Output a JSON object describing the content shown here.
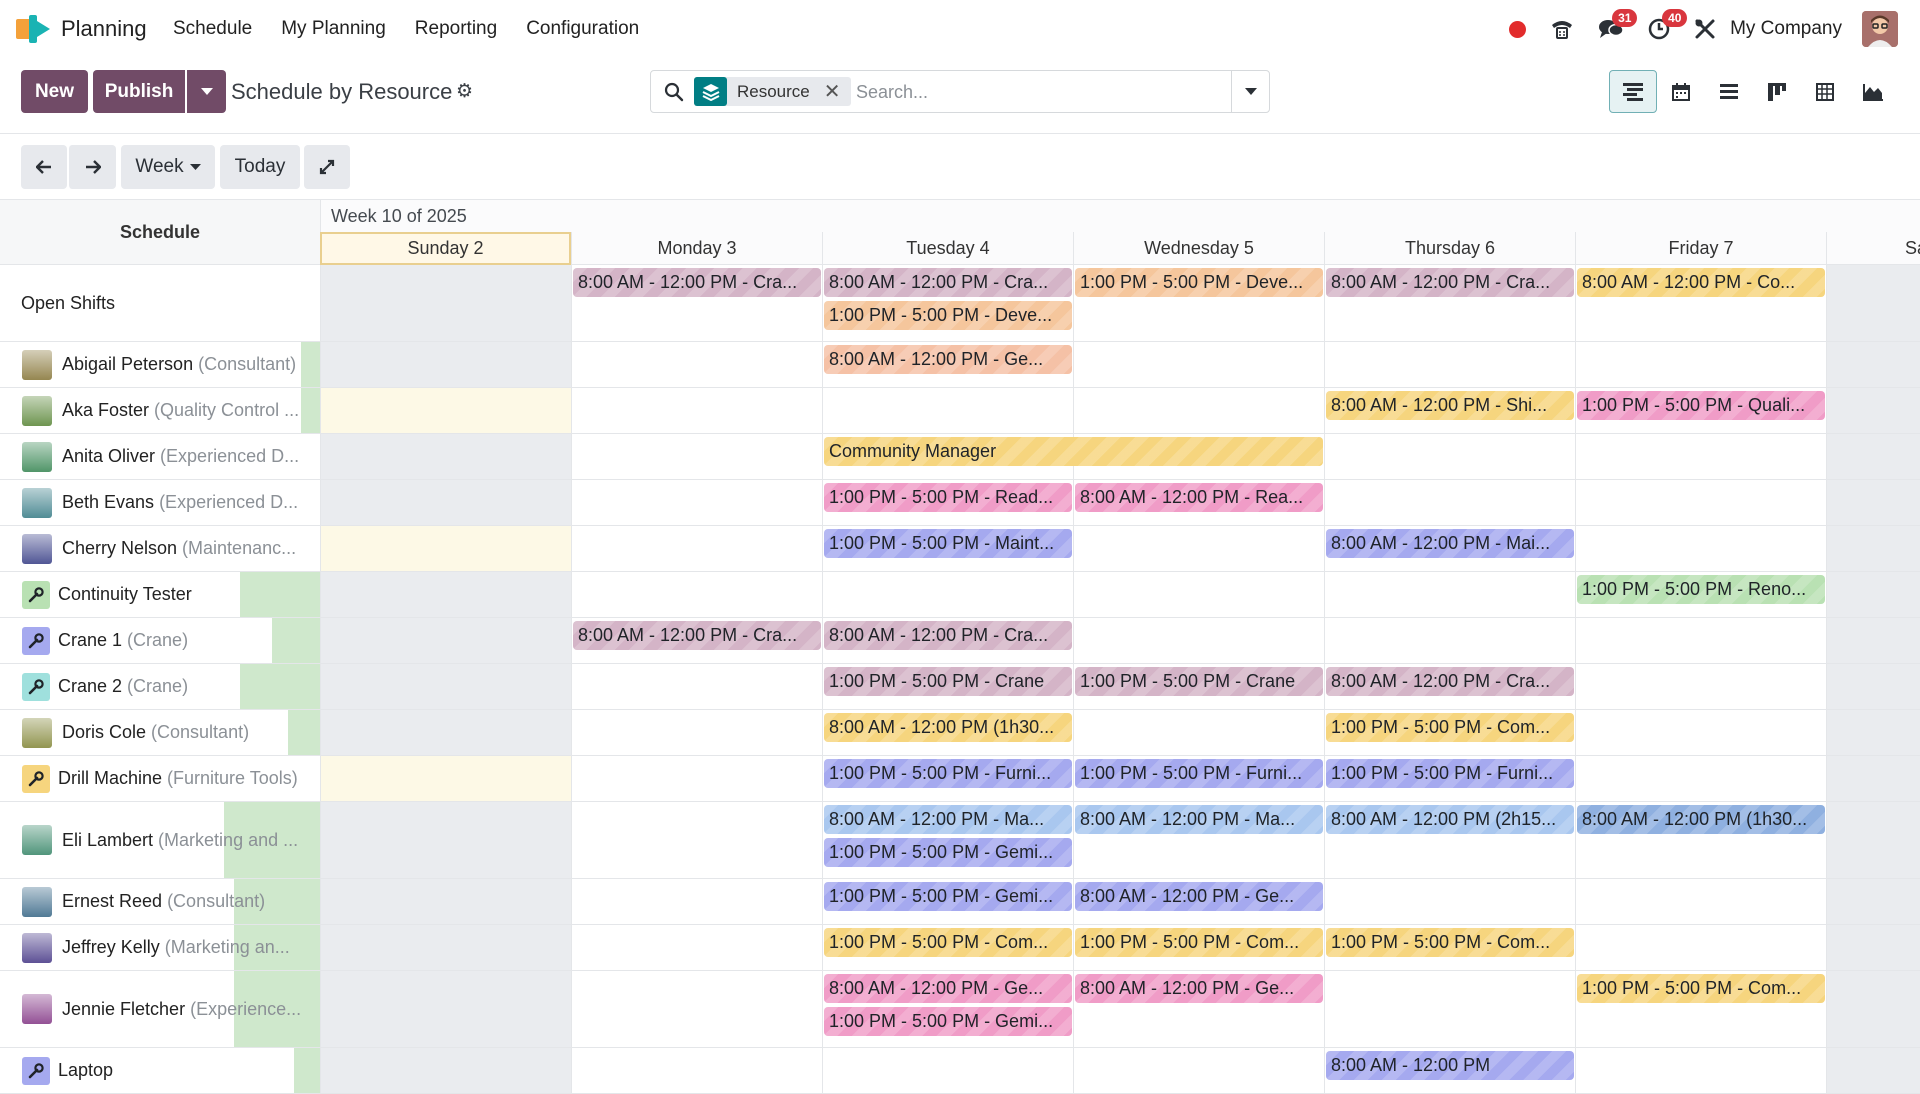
{
  "app": {
    "name": "Planning"
  },
  "nav": {
    "items": [
      "Schedule",
      "My Planning",
      "Reporting",
      "Configuration"
    ]
  },
  "systray": {
    "chat_count": "31",
    "activity_count": "40",
    "company": "My Company"
  },
  "toolbar": {
    "new_label": "New",
    "publish_label": "Publish",
    "title": "Schedule by Resource"
  },
  "search": {
    "facet": "Resource",
    "placeholder": "Search..."
  },
  "subbar": {
    "scale": "Week",
    "today": "Today"
  },
  "gantt": {
    "week_title": "Week 10 of 2025",
    "row_header": "Schedule",
    "days": [
      "Sunday 2",
      "Monday 3",
      "Tuesday 4",
      "Wednesday 5",
      "Thursday 6",
      "Friday 7",
      "Sa"
    ]
  },
  "colors": {
    "brand": "#714b67",
    "today": "#fff8e7",
    "weekend": "#eaecef",
    "availability": "#cfe8cc"
  },
  "rows": [
    {
      "name": "Open Shifts",
      "sub": "",
      "avatar": "none",
      "availability": 0
    },
    {
      "name": "Abigail Peterson",
      "sub": " (Consultant)",
      "avatar": "person",
      "availability": 0.06
    },
    {
      "name": "Aka Foster",
      "sub": " (Quality Control ...",
      "avatar": "person",
      "availability": 0.06
    },
    {
      "name": "Anita Oliver",
      "sub": " (Experienced D...",
      "avatar": "person",
      "availability": 0
    },
    {
      "name": "Beth Evans",
      "sub": " (Experienced D...",
      "avatar": "person",
      "availability": 0
    },
    {
      "name": "Cherry Nelson",
      "sub": " (Maintenanc...",
      "avatar": "person",
      "availability": 0
    },
    {
      "name": "Continuity Tester",
      "sub": "",
      "avatar": "tool",
      "availability": 0.25
    },
    {
      "name": "Crane 1",
      "sub": " (Crane)",
      "avatar": "tool",
      "availability": 0.15
    },
    {
      "name": "Crane 2",
      "sub": " (Crane)",
      "avatar": "tool",
      "availability": 0.25
    },
    {
      "name": "Doris Cole",
      "sub": " (Consultant)",
      "avatar": "person",
      "availability": 0.1
    },
    {
      "name": "Drill Machine",
      "sub": " (Furniture Tools)",
      "avatar": "tool",
      "availability": 0
    },
    {
      "name": "Eli Lambert",
      "sub": " (Marketing and ...",
      "avatar": "person",
      "availability": 0.3
    },
    {
      "name": "Ernest Reed",
      "sub": " (Consultant)",
      "avatar": "person",
      "availability": 0.27
    },
    {
      "name": "Jeffrey Kelly",
      "sub": " (Marketing an...",
      "avatar": "person",
      "availability": 0.27
    },
    {
      "name": "Jennie Fletcher",
      "sub": " (Experience...",
      "avatar": "person",
      "availability": 0.27
    },
    {
      "name": "Laptop",
      "sub": "",
      "avatar": "tool",
      "availability": 0.08
    }
  ],
  "shifts": [
    {
      "row": 0,
      "day": 1,
      "lane": 0,
      "span": 1,
      "text": "8:00 AM - 12:00 PM - Cra...",
      "color": "#d4b4c7"
    },
    {
      "row": 0,
      "day": 2,
      "lane": 0,
      "span": 1,
      "text": "8:00 AM - 12:00 PM - Cra...",
      "color": "#d4b4c7"
    },
    {
      "row": 0,
      "day": 2,
      "lane": 1,
      "span": 1,
      "text": "1:00 PM - 5:00 PM - Deve...",
      "color": "#f5c69c"
    },
    {
      "row": 0,
      "day": 3,
      "lane": 0,
      "span": 1,
      "text": "1:00 PM - 5:00 PM - Deve...",
      "color": "#f5c69c"
    },
    {
      "row": 0,
      "day": 4,
      "lane": 0,
      "span": 1,
      "text": "8:00 AM - 12:00 PM - Cra...",
      "color": "#d4b4c7"
    },
    {
      "row": 0,
      "day": 5,
      "lane": 0,
      "span": 1,
      "text": "8:00 AM - 12:00 PM - Co...",
      "color": "#f6d57e"
    },
    {
      "row": 1,
      "day": 2,
      "lane": 0,
      "span": 1,
      "text": "8:00 AM - 12:00 PM - Ge...",
      "color": "#f5c1a6"
    },
    {
      "row": 2,
      "day": 4,
      "lane": 0,
      "span": 1,
      "text": "8:00 AM - 12:00 PM - Shi...",
      "color": "#f6d57e"
    },
    {
      "row": 2,
      "day": 5,
      "lane": 0,
      "span": 1,
      "text": "1:00 PM - 5:00 PM - Quali...",
      "color": "#f09cc7"
    },
    {
      "row": 3,
      "day": 2,
      "lane": 0,
      "span": 2,
      "text": "Community Manager",
      "color": "#f6d57e"
    },
    {
      "row": 4,
      "day": 2,
      "lane": 0,
      "span": 1,
      "text": "1:00 PM - 5:00 PM - Read...",
      "color": "#f09cc7"
    },
    {
      "row": 4,
      "day": 3,
      "lane": 0,
      "span": 1,
      "text": "8:00 AM - 12:00 PM - Rea...",
      "color": "#f09cc7"
    },
    {
      "row": 5,
      "day": 2,
      "lane": 0,
      "span": 1,
      "text": "1:00 PM - 5:00 PM - Maint...",
      "color": "#a5a9ef"
    },
    {
      "row": 5,
      "day": 4,
      "lane": 0,
      "span": 1,
      "text": "8:00 AM - 12:00 PM - Mai...",
      "color": "#a5a9ef"
    },
    {
      "row": 6,
      "day": 5,
      "lane": 0,
      "span": 1,
      "text": "1:00 PM - 5:00 PM - Reno...",
      "color": "#b9e1b3"
    },
    {
      "row": 7,
      "day": 1,
      "lane": 0,
      "span": 1,
      "text": "8:00 AM - 12:00 PM - Cra...",
      "color": "#d4b4c7"
    },
    {
      "row": 7,
      "day": 2,
      "lane": 0,
      "span": 1,
      "text": "8:00 AM - 12:00 PM - Cra...",
      "color": "#d4b4c7"
    },
    {
      "row": 8,
      "day": 2,
      "lane": 0,
      "span": 1,
      "text": "1:00 PM - 5:00 PM - Crane",
      "color": "#d4b4c7"
    },
    {
      "row": 8,
      "day": 3,
      "lane": 0,
      "span": 1,
      "text": "1:00 PM - 5:00 PM - Crane",
      "color": "#d4b4c7"
    },
    {
      "row": 8,
      "day": 4,
      "lane": 0,
      "span": 1,
      "text": "8:00 AM - 12:00 PM - Cra...",
      "color": "#d4b4c7"
    },
    {
      "row": 9,
      "day": 2,
      "lane": 0,
      "span": 1,
      "text": "8:00 AM - 12:00 PM (1h30...",
      "color": "#f6d57e"
    },
    {
      "row": 9,
      "day": 4,
      "lane": 0,
      "span": 1,
      "text": "1:00 PM - 5:00 PM - Com...",
      "color": "#f6d57e"
    },
    {
      "row": 10,
      "day": 2,
      "lane": 0,
      "span": 1,
      "text": "1:00 PM - 5:00 PM - Furni...",
      "color": "#a5a9ef"
    },
    {
      "row": 10,
      "day": 3,
      "lane": 0,
      "span": 1,
      "text": "1:00 PM - 5:00 PM - Furni...",
      "color": "#a5a9ef"
    },
    {
      "row": 10,
      "day": 4,
      "lane": 0,
      "span": 1,
      "text": "1:00 PM - 5:00 PM - Furni...",
      "color": "#a5a9ef"
    },
    {
      "row": 11,
      "day": 2,
      "lane": 0,
      "span": 1,
      "text": "8:00 AM - 12:00 PM - Ma...",
      "color": "#a9c7ef"
    },
    {
      "row": 11,
      "day": 2,
      "lane": 1,
      "span": 1,
      "text": "1:00 PM - 5:00 PM - Gemi...",
      "color": "#a5a9ef"
    },
    {
      "row": 11,
      "day": 3,
      "lane": 0,
      "span": 1,
      "text": "8:00 AM - 12:00 PM - Ma...",
      "color": "#a9c7ef"
    },
    {
      "row": 11,
      "day": 4,
      "lane": 0,
      "span": 1,
      "text": "8:00 AM - 12:00 PM (2h15...",
      "color": "#a9c7ef"
    },
    {
      "row": 11,
      "day": 5,
      "lane": 0,
      "span": 1,
      "text": "8:00 AM - 12:00 PM (1h30...",
      "color": "#8fb0e0"
    },
    {
      "row": 12,
      "day": 2,
      "lane": 0,
      "span": 1,
      "text": "1:00 PM - 5:00 PM - Gemi...",
      "color": "#a5a9ef"
    },
    {
      "row": 12,
      "day": 3,
      "lane": 0,
      "span": 1,
      "text": "8:00 AM - 12:00 PM - Ge...",
      "color": "#a5a9ef"
    },
    {
      "row": 13,
      "day": 2,
      "lane": 0,
      "span": 1,
      "text": "1:00 PM - 5:00 PM - Com...",
      "color": "#f6d57e"
    },
    {
      "row": 13,
      "day": 3,
      "lane": 0,
      "span": 1,
      "text": "1:00 PM - 5:00 PM - Com...",
      "color": "#f6d57e"
    },
    {
      "row": 13,
      "day": 4,
      "lane": 0,
      "span": 1,
      "text": "1:00 PM - 5:00 PM - Com...",
      "color": "#f6d57e"
    },
    {
      "row": 14,
      "day": 2,
      "lane": 0,
      "span": 1,
      "text": "8:00 AM - 12:00 PM - Ge...",
      "color": "#f09cc7"
    },
    {
      "row": 14,
      "day": 2,
      "lane": 1,
      "span": 1,
      "text": "1:00 PM - 5:00 PM - Gemi...",
      "color": "#f09cc7"
    },
    {
      "row": 14,
      "day": 3,
      "lane": 0,
      "span": 1,
      "text": "8:00 AM - 12:00 PM - Ge...",
      "color": "#f09cc7"
    },
    {
      "row": 14,
      "day": 5,
      "lane": 0,
      "span": 1,
      "text": "1:00 PM - 5:00 PM - Com...",
      "color": "#f6d57e"
    },
    {
      "row": 15,
      "day": 4,
      "lane": 0,
      "span": 1,
      "text": "8:00 AM - 12:00 PM",
      "color": "#a5a9ef"
    }
  ]
}
